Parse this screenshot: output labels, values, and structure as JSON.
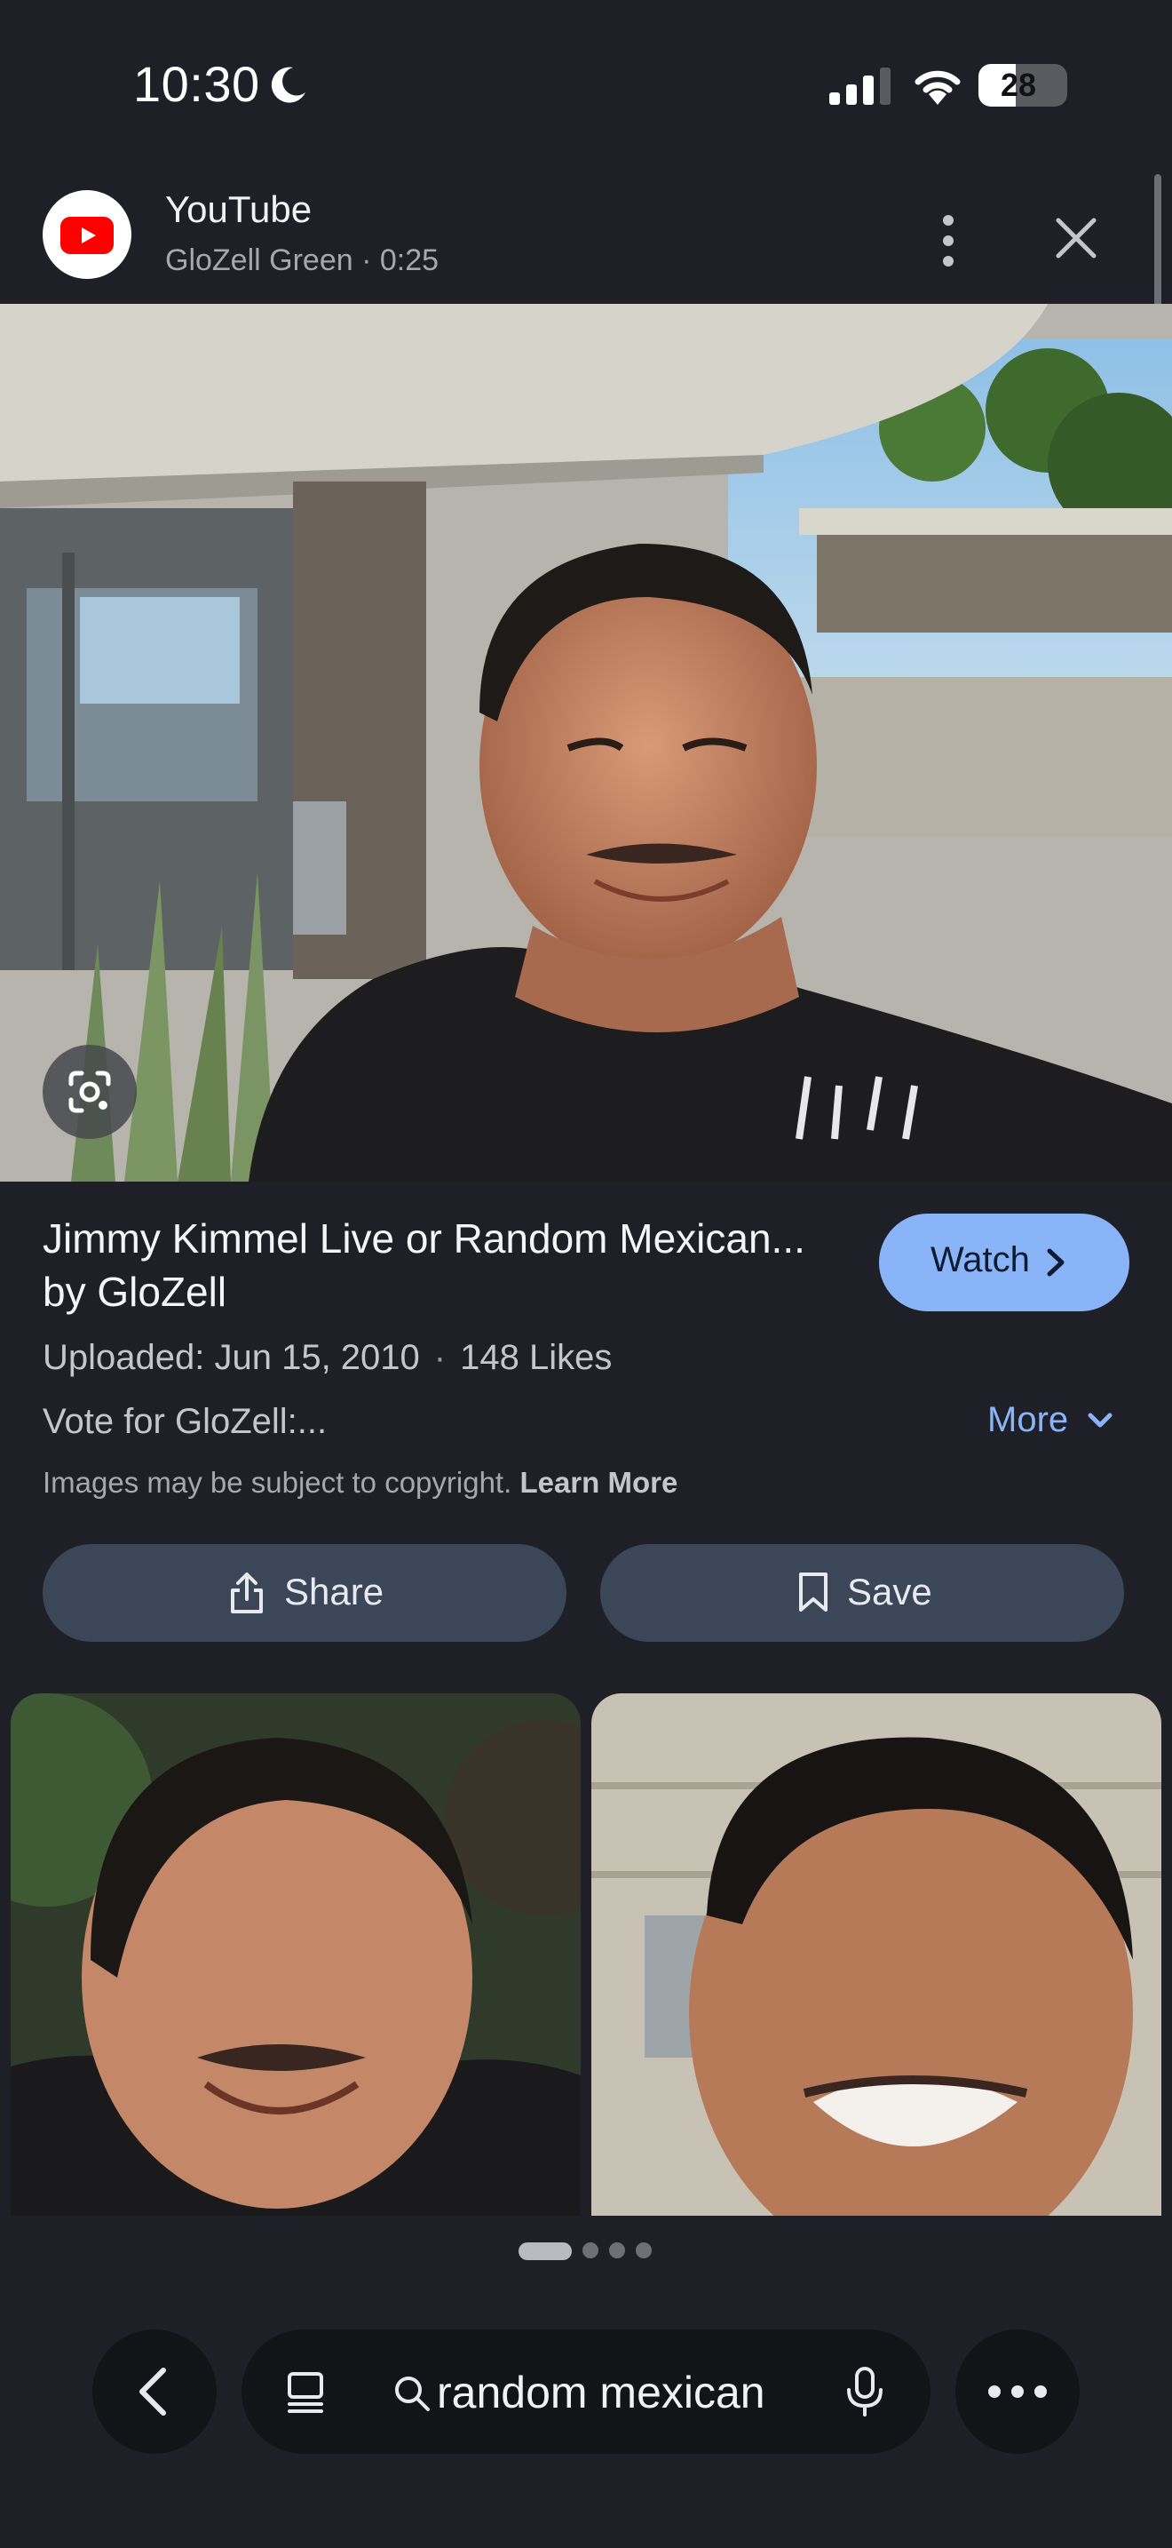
{
  "status_bar": {
    "time": "10:30",
    "battery": "28",
    "icons": [
      "moon-icon",
      "cellular-signal-icon",
      "wifi-icon",
      "battery-icon"
    ]
  },
  "source": {
    "name": "YouTube",
    "meta": "GloZell Green · 0:25",
    "icons": [
      "youtube-logo-icon",
      "more-vert-icon",
      "close-icon"
    ]
  },
  "result": {
    "title": "Jimmy Kimmel Live or Random Mexican... by GloZell",
    "watch_label": "Watch",
    "uploaded": "Uploaded: Jun 15, 2010",
    "separator": "·",
    "likes": "148 Likes",
    "description": "Vote for GloZell:...",
    "more_label": "More",
    "copyright_text": "Images may be subject to copyright.",
    "learn_more": "Learn More"
  },
  "actions": {
    "share_label": "Share",
    "save_label": "Save"
  },
  "search": {
    "query": "random mexican",
    "icons": [
      "back-chevron-icon",
      "tabs-icon",
      "search-icon",
      "mic-icon",
      "more-horiz-icon"
    ]
  },
  "colors": {
    "background": "#1f2027",
    "accent": "#8ab4f8",
    "button_bg": "#3b4658"
  },
  "pager": {
    "count": 4,
    "active_index": 0
  }
}
